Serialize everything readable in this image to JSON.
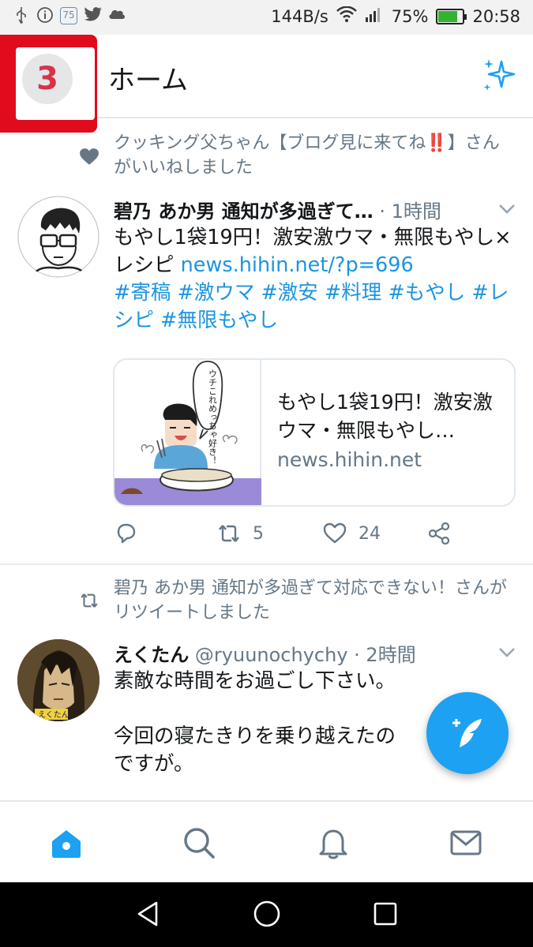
{
  "status_bar": {
    "network_speed": "144B/s",
    "battery_percent": "75%",
    "time": "20:58",
    "notif_badge": "75",
    "left_icons": [
      "usb-icon",
      "info-icon",
      "app-badge-icon",
      "twitter-bird-icon",
      "cloud-icon"
    ],
    "right_icons": [
      "wifi-icon",
      "signal-icon",
      "battery-icon"
    ]
  },
  "header": {
    "title": "ホーム",
    "avatar_badge": "3",
    "highlight_color": "#e00b1c",
    "accent_color": "#1da1f2"
  },
  "tweets": [
    {
      "social_context": "クッキング父ちゃん【ブログ見に来てね‼️】さんがいいねしました",
      "social_icon": "heart-icon",
      "display_name": "碧乃 あか男 通知が多過ぎて…",
      "handle": "",
      "time": "· 1時間",
      "text_plain": "もやし1袋19円！激安激ウマ・無限もやし×レシピ ",
      "link": "news.hihin.net/?p=696",
      "hashtags": "#寄稿 #激ウマ #激安 #料理 #もやし #レシピ #無限もやし",
      "card": {
        "title": "もやし1袋19円！激安激ウマ・無限もやし…",
        "domain": "news.hihin.net",
        "speech_bubble": "ウチこれめっちゃ好き！"
      },
      "retweets": "5",
      "likes": "24"
    },
    {
      "social_context": "碧乃 あか男 通知が多過ぎて対応できない！さんがリツイートしました",
      "social_icon": "retweet-icon",
      "display_name": "えくたん",
      "handle": "@ryuunochychy",
      "time": "· 2時間",
      "text_line1": "素敵な時間をお過ごし下さい。",
      "text_line2": "今回の寝たきりを乗り越えたの",
      "text_line3": "ですが。",
      "avatar_label": "えくたん"
    }
  ],
  "bottom_tabs": [
    "home-icon",
    "search-icon",
    "notifications-icon",
    "messages-icon"
  ],
  "nav_buttons": [
    "back-icon",
    "home-circle-icon",
    "recents-icon"
  ]
}
